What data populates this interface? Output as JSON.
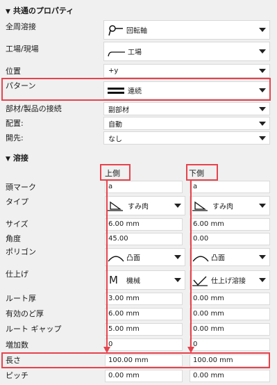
{
  "common": {
    "header": "共通のプロパティ",
    "rows": {
      "weld_around": {
        "label": "全周溶接",
        "value": "回転軸"
      },
      "shop_site": {
        "label": "工場/現場",
        "value": "工場"
      },
      "position": {
        "label": "位置",
        "value": "+y"
      },
      "pattern": {
        "label": "パターン",
        "value": "連続"
      },
      "part_connection": {
        "label": "部材/製品の接続",
        "value": "副部材"
      },
      "placement": {
        "label": "配置:",
        "value": "自動"
      },
      "opening": {
        "label": "開先:",
        "value": "なし"
      }
    }
  },
  "weld": {
    "header": "溶接",
    "column_upper": "上側",
    "column_lower": "下側",
    "rows": {
      "prefix": {
        "label": "頭マーク",
        "upper": "a",
        "lower": "a"
      },
      "type": {
        "label": "タイプ",
        "upper": "すみ肉",
        "lower": "すみ肉"
      },
      "size": {
        "label": "サイズ",
        "upper": "6.00 mm",
        "lower": "6.00 mm"
      },
      "angle": {
        "label": "角度",
        "upper": "45.00",
        "lower": "0.00"
      },
      "contour": {
        "label": "ポリゴン",
        "upper": "凸面",
        "lower": "凸面"
      },
      "finish": {
        "label": "仕上げ",
        "upper": "機械",
        "lower": "仕上げ溶接"
      },
      "root_face": {
        "label": "ルート厚",
        "upper": "3.00 mm",
        "lower": "0.00 mm"
      },
      "throat": {
        "label": "有効のど厚",
        "upper": "6.00 mm",
        "lower": "0.00 mm"
      },
      "root_gap": {
        "label": "ルート ギャップ",
        "upper": "5.00 mm",
        "lower": "0.00 mm"
      },
      "increments": {
        "label": "増加数",
        "upper": "0",
        "lower": "0"
      },
      "length": {
        "label": "長さ",
        "upper": "100.00 mm",
        "lower": "100.00 mm"
      },
      "pitch": {
        "label": "ピッチ",
        "upper": "0.00 mm",
        "lower": "0.00 mm"
      }
    }
  },
  "icons": {
    "weld_around": "rotation-axis-icon",
    "shop_site": "shop-weld-icon",
    "pattern": "continuous-pattern-icon",
    "fillet": "fillet-weld-icon",
    "convex": "convex-contour-icon",
    "machine": "machine-finish-icon",
    "finish_weld": "finish-weld-icon"
  },
  "colors": {
    "highlight": "#e8424c"
  }
}
